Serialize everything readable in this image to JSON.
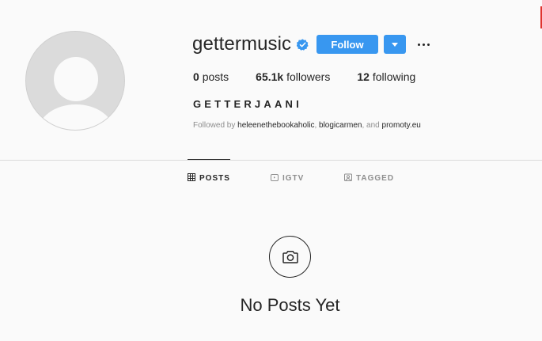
{
  "profile": {
    "username": "gettermusic",
    "verified": true,
    "verified_icon": "verified-badge-icon",
    "full_name": "GETTERJAANI",
    "avatar_icon": "default-avatar-icon"
  },
  "actions": {
    "follow_label": "Follow",
    "dropdown_icon": "chevron-down-icon",
    "more_icon": "more-options-icon"
  },
  "stats": [
    {
      "value": "0",
      "label": "posts"
    },
    {
      "value": "65.1k",
      "label": "followers"
    },
    {
      "value": "12",
      "label": "following"
    }
  ],
  "followed_by": {
    "prefix": "Followed by",
    "accounts": [
      "heleenethebookaholic",
      "blogicarmen",
      "promoty.eu"
    ],
    "sep1": ",",
    "sep2": ", and"
  },
  "tabs": [
    {
      "label": "POSTS",
      "icon": "grid-icon",
      "active": true
    },
    {
      "label": "IGTV",
      "icon": "igtv-icon",
      "active": false
    },
    {
      "label": "TAGGED",
      "icon": "tagged-icon",
      "active": false
    }
  ],
  "empty_state": {
    "icon": "camera-icon",
    "title": "No Posts Yet"
  },
  "colors": {
    "accent": "#3897f0",
    "text": "#262626",
    "muted": "#8e8e8e",
    "background": "#fafafa",
    "divider": "#dbdbdb"
  }
}
